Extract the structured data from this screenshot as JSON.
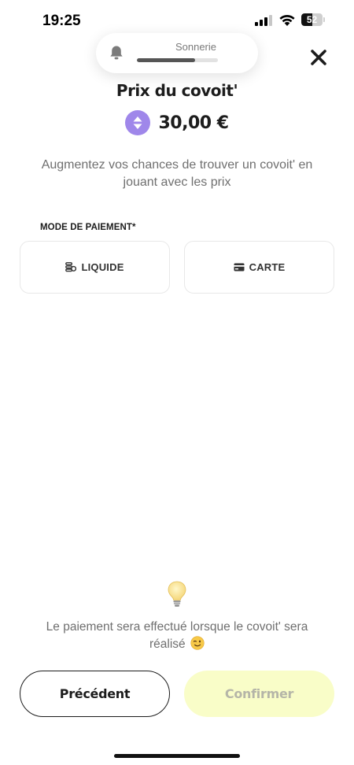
{
  "status_bar": {
    "time": "19:25",
    "battery_level": "52",
    "battery_fraction": 0.52
  },
  "ringer": {
    "label": "Sonnerie",
    "volume_fraction": 0.72
  },
  "header": {
    "title": "Prix du covoit'",
    "price": "30,00 €",
    "close_icon": "close-icon",
    "stepper_icon": "up-down-arrows-icon"
  },
  "subtitle": "Augmentez vos chances de trouver un covoit' en jouant avec les prix",
  "payment": {
    "section_label": "MODE DE PAIEMENT*",
    "options": [
      {
        "label": "LIQUIDE",
        "icon": "coins-icon"
      },
      {
        "label": "CARTE",
        "icon": "credit-card-icon"
      }
    ]
  },
  "info": {
    "icon": "lightbulb-icon",
    "text": "Le paiement sera effectué lorsque le covoit' sera réalisé",
    "emoji_icon": "winking-face-icon"
  },
  "buttons": {
    "previous": "Précédent",
    "confirm": "Confirmer"
  },
  "colors": {
    "accent_purple": "#9f87ea",
    "confirm_bg": "#f9fdc8",
    "confirm_text": "#b5b5a8",
    "text_dark": "#1c1c1c",
    "text_muted": "#6f6f6f"
  }
}
